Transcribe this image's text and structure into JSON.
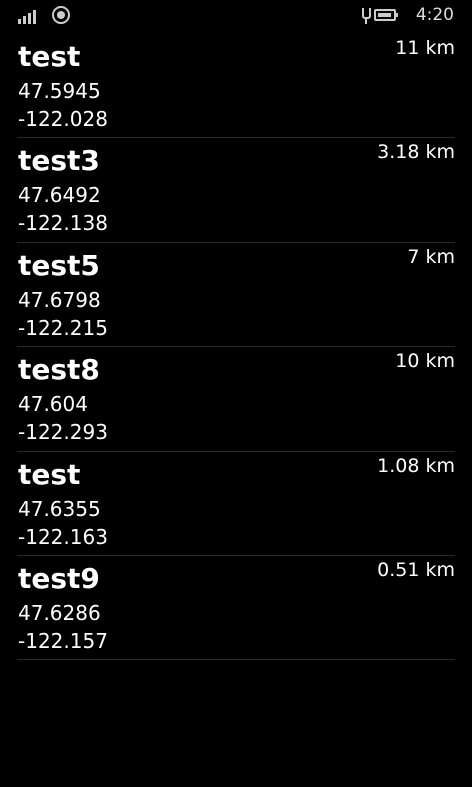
{
  "status": {
    "time": "4:20",
    "battery_level": 0.9
  },
  "places": [
    {
      "name": "test",
      "lat": "47.5945",
      "lon": "-122.028",
      "distance": "11 km"
    },
    {
      "name": "test3",
      "lat": "47.6492",
      "lon": "-122.138",
      "distance": "3.18 km"
    },
    {
      "name": "test5",
      "lat": "47.6798",
      "lon": "-122.215",
      "distance": "7 km"
    },
    {
      "name": "test8",
      "lat": "47.604",
      "lon": "-122.293",
      "distance": "10 km"
    },
    {
      "name": "test",
      "lat": "47.6355",
      "lon": "-122.163",
      "distance": "1.08 km"
    },
    {
      "name": "test9",
      "lat": "47.6286",
      "lon": "-122.157",
      "distance": "0.51 km"
    }
  ]
}
